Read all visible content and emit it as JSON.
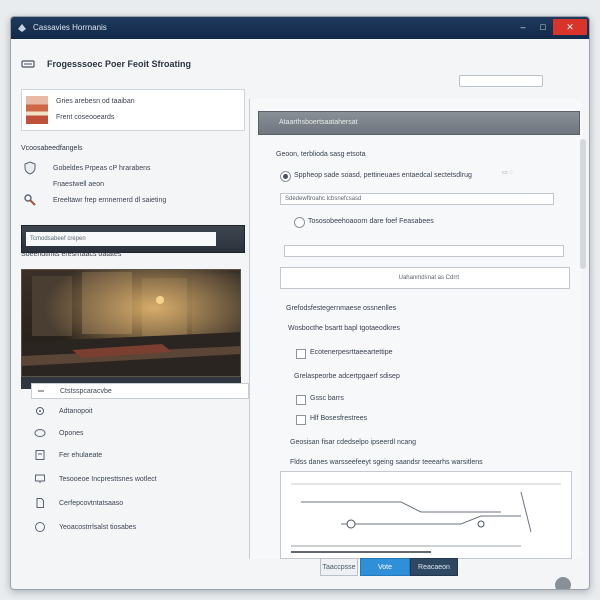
{
  "window": {
    "title": "Cassavies Horrnanis"
  },
  "toolbar": {
    "title": "Frogesssoec Poer Feoit Sfroating",
    "field_value": ""
  },
  "profile": {
    "line1": "Gries arebesn od taaiban",
    "line2": "Frent coseooeards"
  },
  "left_section": {
    "title": "Vcoosabeedfangels",
    "options": [
      "Gobeldes Prpeas cP hrarabens",
      "Fnaestwell aeon",
      "Ereeltawr frep ernnernerd dl saieting"
    ],
    "dark_input": "Tcmodsabeef crepen"
  },
  "preview": {
    "title": "Soeendtinits eresrrtaacs oatates"
  },
  "nav_items": [
    "Ctstsspcaracvbe",
    "Adtanopoit",
    "Opones",
    "Fer ehulaeate",
    "Tesooeoe Incpresttsnes wotlect",
    "Cerfepcovtntatsaaso",
    "Yeoacostrrlsalst tiosabes"
  ],
  "right_panel": {
    "header": "Ataarthsboertsaatahersat",
    "section1_title": "Geoon, terblioda sasg etsota",
    "radio1": "Sppheop sade soasd, pettineuaes entaedcal sectetsdlrug",
    "field1": "Sdedewftroahc lcbsnefcsasd",
    "radio2": "Tososobeehoaoorn dare foef Feasabees",
    "field2": "",
    "field3": "Uahanmdsnat as Cdrrt",
    "section2_title": "Grefodsfestegernmaese ossnenlles",
    "sub_label": "Wosbocthe bsartt bapl tgotaeodkres",
    "check1": "Ecotenerpesrttaeeartettipe",
    "section3_title": "Grelaspeorbe adcertpgaerf sdisep",
    "check2": "Gssc barrs",
    "check3": "Hlf Bosesfrestrees",
    "section4_title": "Geosisan fisar cdedselpo ipseerdl ncang",
    "diagram_title": "Fldss danes warsseefeeyt sgeing saandsr teeearhs warsitlens"
  },
  "footer": {
    "secondary_label": "Taaccpsse",
    "primary_label": "Vote",
    "dark_label": "Reacaeon"
  }
}
